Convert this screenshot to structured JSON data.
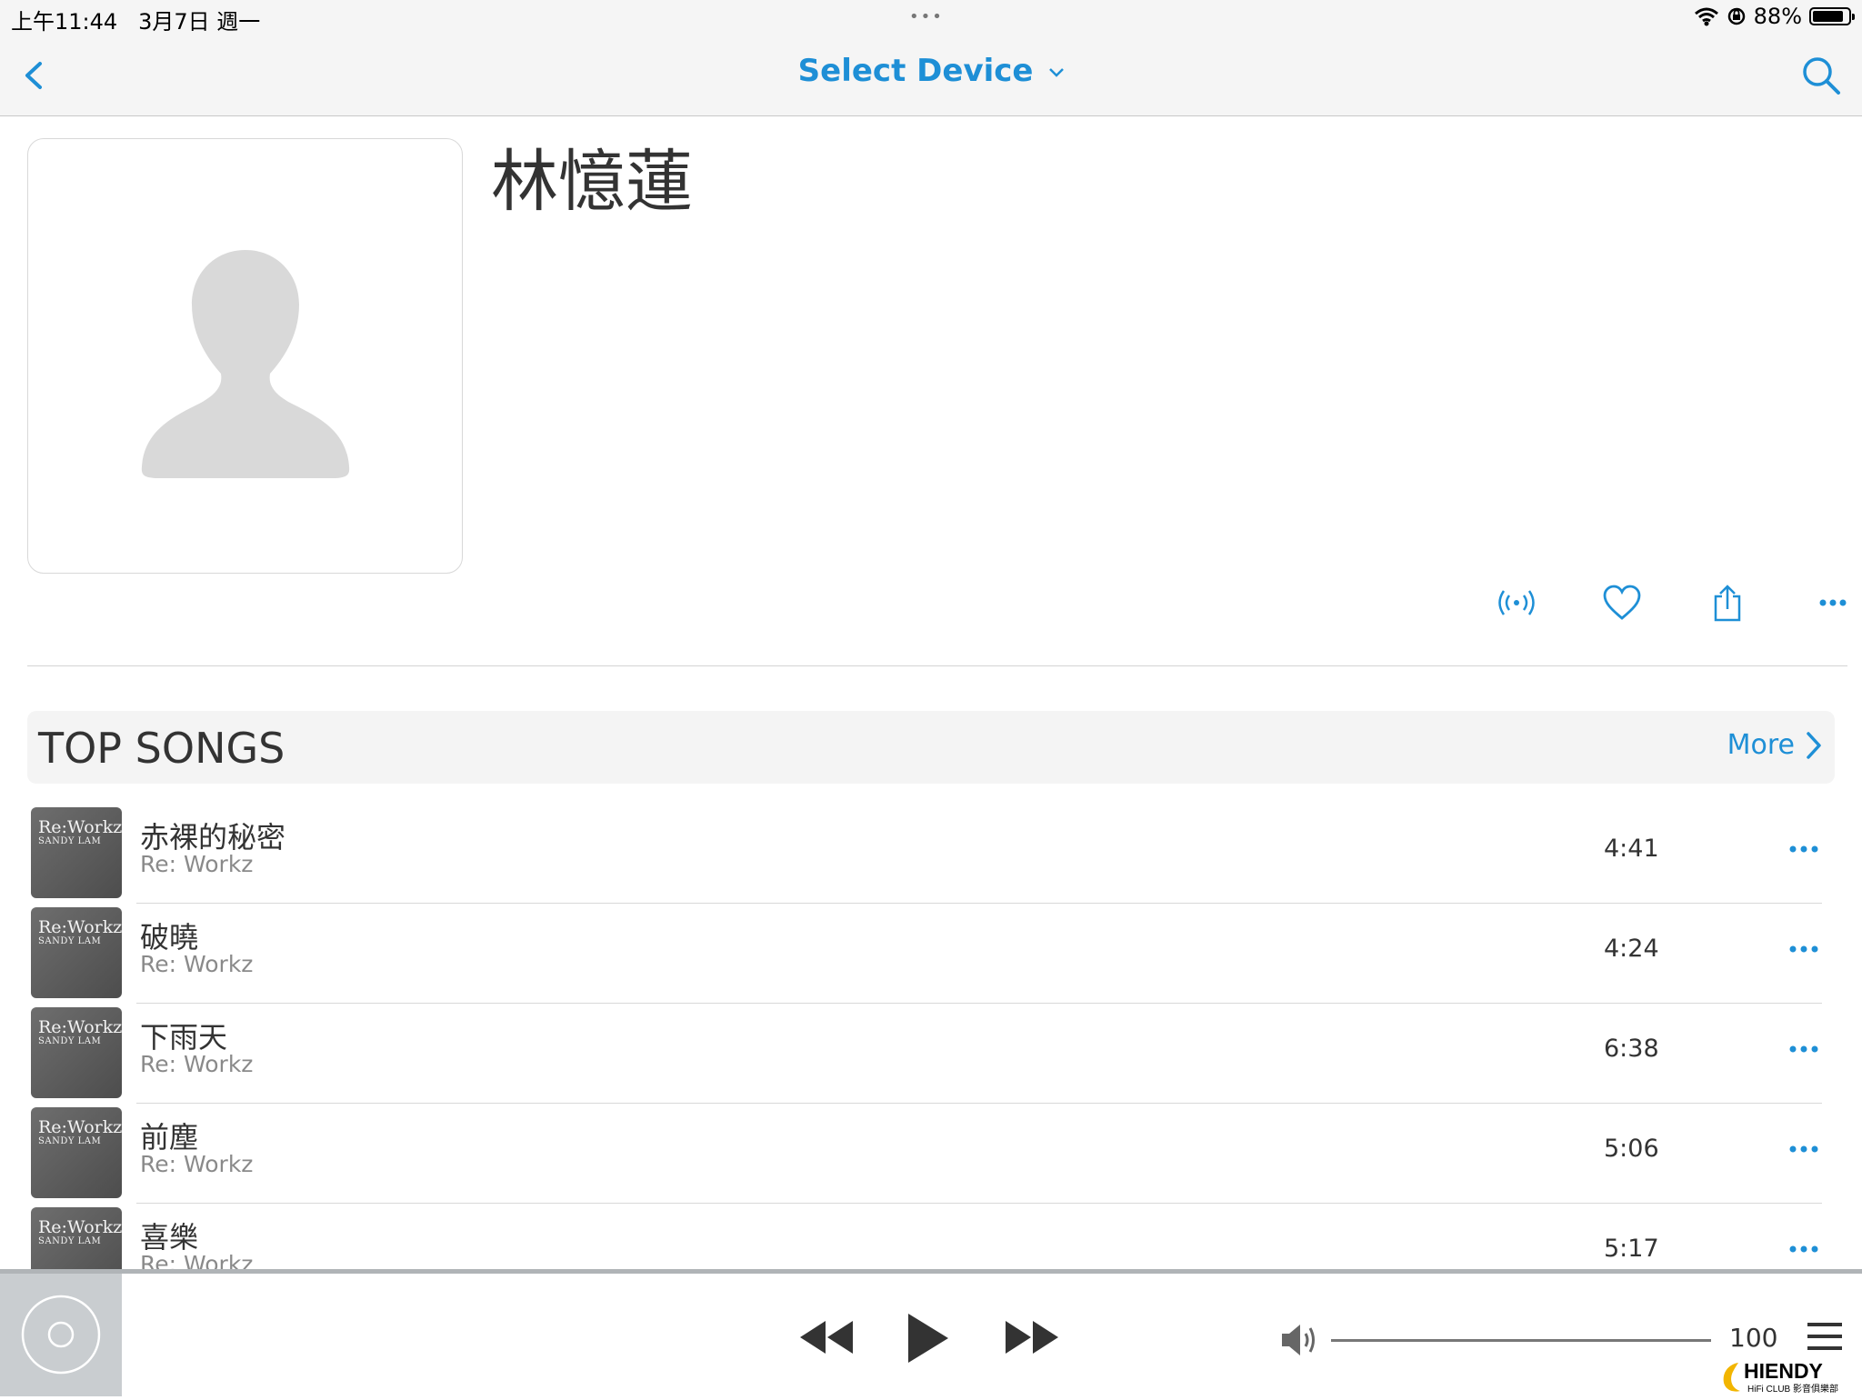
{
  "status_bar": {
    "time": "上午11:44",
    "date": "3月7日 週一",
    "center_dots": "•••",
    "battery_percent": "88%",
    "battery_level": 0.88
  },
  "navbar": {
    "title": "Select Device",
    "accent_color": "#1e8fd6"
  },
  "artist": {
    "name": "林憶蓮"
  },
  "section": {
    "title": "TOP SONGS",
    "more_label": "More"
  },
  "cover_text": {
    "line1": "Re:Workz",
    "line2": "SANDY LAM"
  },
  "songs": [
    {
      "title": "赤裸的秘密",
      "album": "Re: Workz",
      "duration": "4:41"
    },
    {
      "title": "破曉",
      "album": "Re: Workz",
      "duration": "4:24"
    },
    {
      "title": "下雨天",
      "album": "Re: Workz",
      "duration": "6:38"
    },
    {
      "title": "前塵",
      "album": "Re: Workz",
      "duration": "5:06"
    },
    {
      "title": "喜樂",
      "album": "Re: Workz",
      "duration": "5:17"
    }
  ],
  "player": {
    "volume_value": "100"
  },
  "watermark": {
    "brand": "HIENDY",
    "subtitle": "HiFi CLUB 影音俱樂部"
  }
}
